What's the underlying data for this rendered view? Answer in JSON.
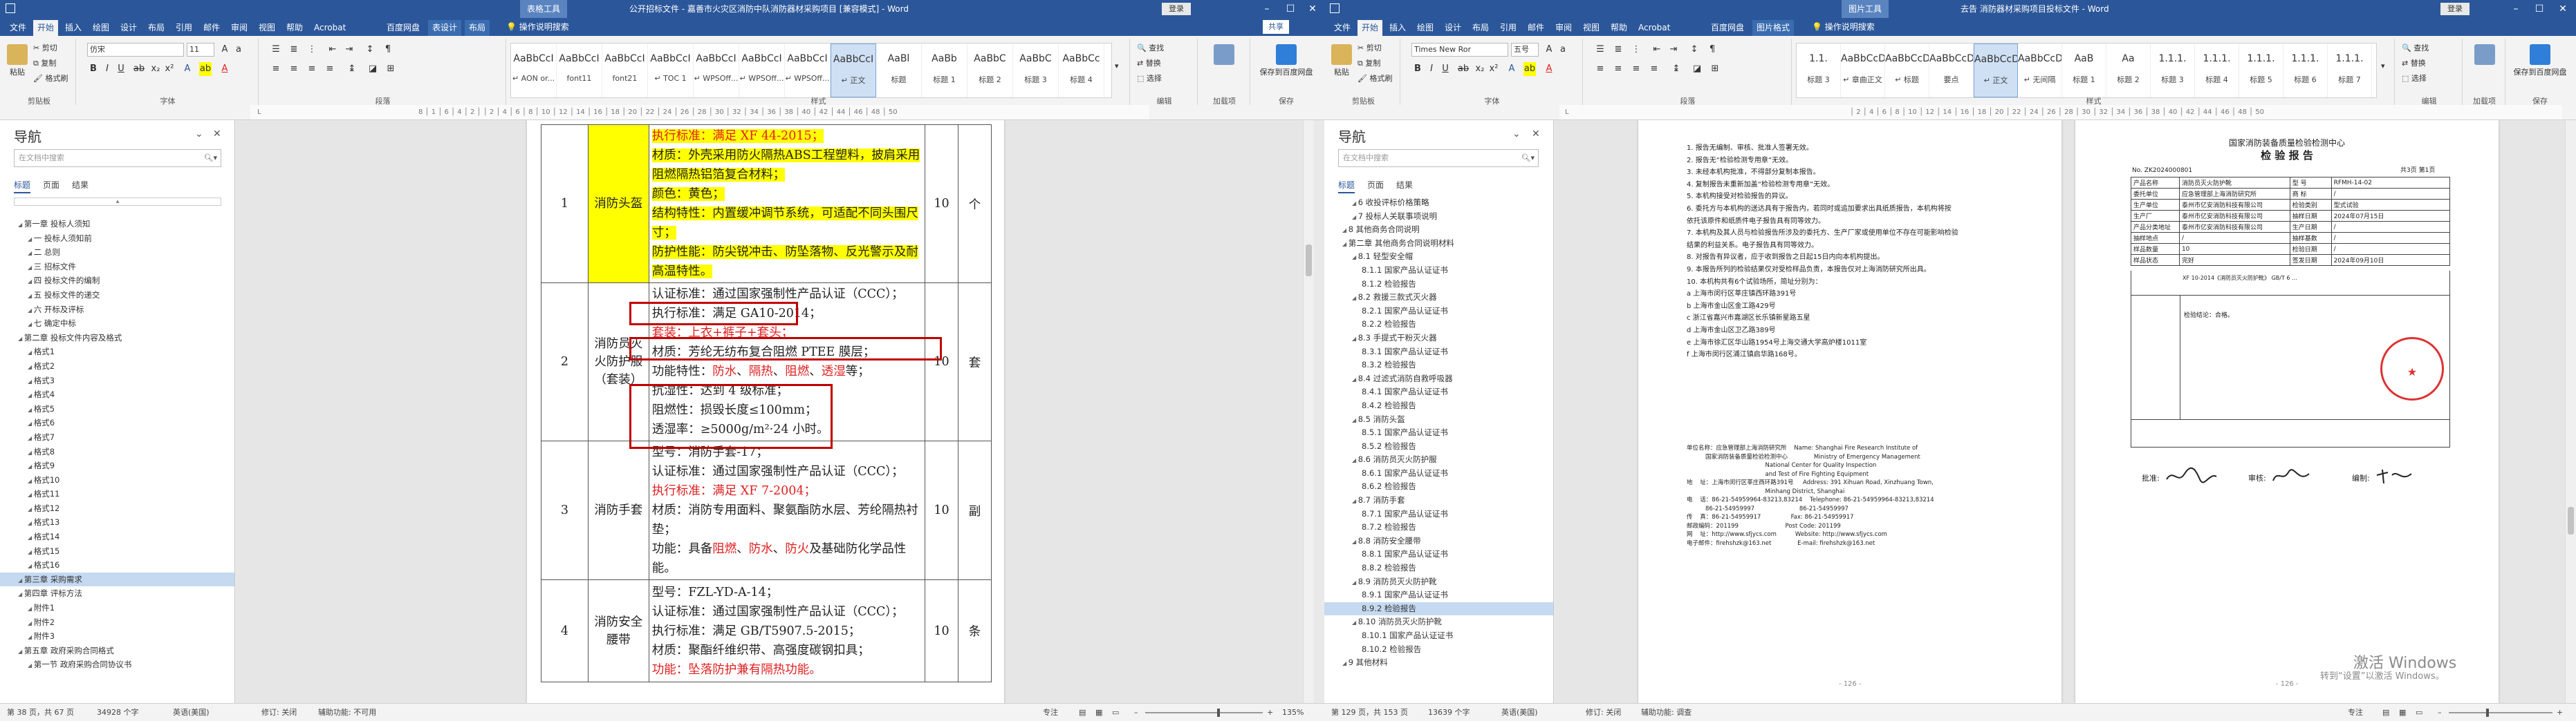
{
  "left": {
    "titlebar": {
      "context_tab": "表格工具",
      "title": "公开招标文件 - 嘉善市火灾区消防中队消防器材采购项目 [兼容模式] - Word",
      "signin": "登录"
    },
    "tabs": [
      "文件",
      "开始",
      "插入",
      "绘图",
      "设计",
      "布局",
      "引用",
      "邮件",
      "审阅",
      "视图",
      "帮助",
      "Acrobat",
      "百度网盘",
      "表设计",
      "布局"
    ],
    "tell_me": "操作说明搜索",
    "share": "共享",
    "ribbon": {
      "clipboard": {
        "paste": "粘贴",
        "cut": "剪切",
        "copy": "复制",
        "format_painter": "格式刷",
        "label": "剪贴板"
      },
      "font": {
        "name": "仿宋",
        "size": "11",
        "label": "字体"
      },
      "paragraph": {
        "label": "段落"
      },
      "styles": {
        "label": "样式",
        "items": [
          {
            "preview": "AaBbCcI",
            "name": "↵ AON or..."
          },
          {
            "preview": "AaBbCcI",
            "name": "font11"
          },
          {
            "preview": "AaBbCcI",
            "name": "font21"
          },
          {
            "preview": "AaBbCcI",
            "name": "↵ TOC 1"
          },
          {
            "preview": "AaBbCcI",
            "name": "↵ WPSOff..."
          },
          {
            "preview": "AaBbCcI",
            "name": "↵ WPSOff..."
          },
          {
            "preview": "AaBbCcI",
            "name": "↵ WPSOff..."
          },
          {
            "preview": "AaBbCcI",
            "name": "↵ 正文"
          },
          {
            "preview": "AaBl",
            "name": "标题"
          },
          {
            "preview": "AaBb",
            "name": "标题 1"
          },
          {
            "preview": "AaBbC",
            "name": "标题 2"
          },
          {
            "preview": "AaBbC",
            "name": "标题 3"
          },
          {
            "preview": "AaBbCc",
            "name": "标题 4"
          }
        ]
      },
      "editing": {
        "find": "查找",
        "replace": "替换",
        "select": "选择",
        "label": "编辑"
      },
      "reuse": {
        "save": "保存到百度网盘",
        "label": "保存"
      },
      "addin": {
        "label": "加载项"
      }
    },
    "nav": {
      "title": "导航",
      "search_placeholder": "在文档中搜索",
      "tabs": [
        "标题",
        "页面",
        "结果"
      ],
      "items": [
        {
          "text": "第一章  投标人须知",
          "level": 0
        },
        {
          "text": "一  投标人须知前",
          "level": 1
        },
        {
          "text": "二  总则",
          "level": 1
        },
        {
          "text": "三  招标文件",
          "level": 1
        },
        {
          "text": "四  投标文件的编制",
          "level": 1
        },
        {
          "text": "五  投标文件的递交",
          "level": 1
        },
        {
          "text": "六  开标及评标",
          "level": 1
        },
        {
          "text": "七  确定中标",
          "level": 1
        },
        {
          "text": "第二章  投标文件内容及格式",
          "level": 0
        },
        {
          "text": "格式1",
          "level": 1
        },
        {
          "text": "格式2",
          "level": 1
        },
        {
          "text": "格式3",
          "level": 1
        },
        {
          "text": "格式4",
          "level": 1
        },
        {
          "text": "格式5",
          "level": 1
        },
        {
          "text": "格式6",
          "level": 1
        },
        {
          "text": "格式7",
          "level": 1
        },
        {
          "text": "格式8",
          "level": 1
        },
        {
          "text": "格式9",
          "level": 1
        },
        {
          "text": "格式10",
          "level": 1
        },
        {
          "text": "格式11",
          "level": 1
        },
        {
          "text": "格式12",
          "level": 1
        },
        {
          "text": "格式13",
          "level": 1
        },
        {
          "text": "格式14",
          "level": 1
        },
        {
          "text": "格式15",
          "level": 1
        },
        {
          "text": "格式16",
          "level": 1
        },
        {
          "text": "第三章  采购需求",
          "level": 0,
          "selected": true
        },
        {
          "text": "第四章  评标方法",
          "level": 0
        },
        {
          "text": "附件1",
          "level": 1
        },
        {
          "text": "附件2",
          "level": 1
        },
        {
          "text": "附件3",
          "level": 1
        },
        {
          "text": "第五章  政府采购合同格式",
          "level": 0
        },
        {
          "text": "第一节  政府采购合同协议书",
          "level": 1
        }
      ]
    },
    "table": {
      "rows": [
        {
          "no": "1",
          "name": "消防头盔",
          "qty": "10",
          "unit": "个",
          "lines": [
            {
              "t": "执行标准：满足 XF 44-2015；",
              "red": true,
              "hl": true
            },
            {
              "t": "材质：外壳采用防火隔热ABS工程塑料，披肩采用阻燃隔热铝箔复合材料；",
              "hl": true
            },
            {
              "t": "颜色：黄色；",
              "hl": true
            },
            {
              "t": "结构特性：内置缓冲调节系统，可适配不同头围尺寸；",
              "hl": true
            },
            {
              "t": "防护性能：防尖锐冲击、防坠落物、反光警示及耐高温特性。",
              "hl": true
            }
          ]
        },
        {
          "no": "2",
          "name": "消防员灭火防护服（套装）",
          "qty": "10",
          "unit": "套",
          "lines": [
            {
              "t": "认证标准：通过国家强制性产品认证（CCC）；"
            },
            {
              "t": "执行标准：满足 GA10-2014；"
            },
            {
              "t": "套装：上衣+裤子+套头；",
              "red": true
            },
            {
              "t": "材质：芳纶无纺布复合阻燃 PTEE 膜层；"
            },
            {
              "t": "功能特性：防水、隔热、阻燃、透湿等；",
              "mixed": true
            },
            {
              "t": "抗湿性：达到 4 级标准；"
            },
            {
              "t": "阻燃性：损毁长度≤100mm；"
            },
            {
              "t": "透湿率：≥5000g/m²·24 小时。"
            }
          ]
        },
        {
          "no": "3",
          "name": "消防手套",
          "qty": "10",
          "unit": "副",
          "lines": [
            {
              "t": "型号：消防手套-17；"
            },
            {
              "t": "认证标准：通过国家强制性产品认证（CCC）；"
            },
            {
              "t": "执行标准：满足 XF 7-2004；",
              "red": true
            },
            {
              "t": "材质：消防专用面料、聚氨酯防水层、芳纶隔热衬垫；"
            },
            {
              "t": "功能：具备阻燃、防水、防火及基础防化学品性能。",
              "mixed2": true
            }
          ]
        },
        {
          "no": "4",
          "name": "消防安全腰带",
          "qty": "10",
          "unit": "条",
          "lines": [
            {
              "t": "型号：FZL-YD-A-14；"
            },
            {
              "t": "认证标准：通过国家强制性产品认证（CCC）；"
            },
            {
              "t": "执行标准：满足 GB/T5907.5-2015；"
            },
            {
              "t": "材质：聚酯纤维织带、高强度碳钢扣具；"
            },
            {
              "t": "功能：坠落防护兼有隔热功能。",
              "red": true
            }
          ]
        }
      ]
    },
    "status": {
      "page": "第 38 页，共 67 页",
      "words": "34928 个字",
      "lang": "英语(美国)",
      "track": "修订: 关闭",
      "access": "辅助功能: 不可用",
      "focus": "专注",
      "zoom": "135%"
    }
  },
  "right": {
    "titlebar": {
      "context_tab": "图片工具",
      "title": "去告 消防器材采购项目投标文件 - Word",
      "signin": "登录"
    },
    "tabs": [
      "文件",
      "开始",
      "插入",
      "绘图",
      "设计",
      "布局",
      "引用",
      "邮件",
      "审阅",
      "视图",
      "帮助",
      "Acrobat",
      "百度网盘",
      "图片格式"
    ],
    "tell_me": "操作说明搜索",
    "ribbon": {
      "clipboard": {
        "paste": "粘贴",
        "cut": "剪切",
        "copy": "复制",
        "format_painter": "格式刷",
        "label": "剪贴板"
      },
      "font": {
        "name": "Times New Ror",
        "size": "五号",
        "label": "字体"
      },
      "paragraph": {
        "label": "段落"
      },
      "styles": {
        "label": "样式",
        "items": [
          {
            "preview": "1.1.",
            "name": "标题 3"
          },
          {
            "preview": "AaBbCcD",
            "name": "↵ 章曲正文"
          },
          {
            "preview": "AaBbCcD",
            "name": "↵ 标题"
          },
          {
            "preview": "AaBbCcD",
            "name": "要点"
          },
          {
            "preview": "AaBbCcD",
            "name": "↵ 正文"
          },
          {
            "preview": "AaBbCcD",
            "name": "↵ 无间隔"
          },
          {
            "preview": "AaB",
            "name": "标题 1"
          },
          {
            "preview": "Aa",
            "name": "标题 2"
          },
          {
            "preview": "1.1.1.",
            "name": "标题 3"
          },
          {
            "preview": "1.1.1.",
            "name": "标题 4"
          },
          {
            "preview": "1.1.1.",
            "name": "标题 5"
          },
          {
            "preview": "1.1.1.",
            "name": "标题 6"
          },
          {
            "preview": "1.1.1.",
            "name": "标题 7"
          }
        ]
      },
      "editing": {
        "find": "查找",
        "replace": "替换",
        "select": "选择",
        "label": "编辑"
      },
      "reuse": {
        "save": "保存到百度网盘",
        "label": "保存"
      },
      "addin": {
        "label": "加载项"
      }
    },
    "nav": {
      "title": "导航",
      "search_placeholder": "在文档中搜索",
      "tabs": [
        "标题",
        "页面",
        "结果"
      ],
      "items": [
        {
          "text": "6 收投评标价格策略",
          "level": 1
        },
        {
          "text": "7 投标人关联事项说明",
          "level": 1
        },
        {
          "text": "8  其他商务合同说明",
          "level": 0
        },
        {
          "text": "第二章  其他商务合同说明材料",
          "level": 0
        },
        {
          "text": "8.1 轻型安全帽",
          "level": 1
        },
        {
          "text": "8.1.1 国家产品认证证书",
          "level": 2
        },
        {
          "text": "8.1.2 检验报告",
          "level": 2
        },
        {
          "text": "8.2 救援三款式灭火器",
          "level": 1
        },
        {
          "text": "8.2.1 国家产品认证证书",
          "level": 2
        },
        {
          "text": "8.2.2 检验报告",
          "level": 2
        },
        {
          "text": "8.3 手提式干粉灭火器",
          "level": 1
        },
        {
          "text": "8.3.1 国家产品认证证书",
          "level": 2
        },
        {
          "text": "8.3.2 检验报告",
          "level": 2
        },
        {
          "text": "8.4 过滤式消防自救呼吸器",
          "level": 1
        },
        {
          "text": "8.4.1 国家产品认证证书",
          "level": 2
        },
        {
          "text": "8.4.2 检验报告",
          "level": 2
        },
        {
          "text": "8.5 消防头盔",
          "level": 1
        },
        {
          "text": "8.5.1 国家产品认证证书",
          "level": 2
        },
        {
          "text": "8.5.2 检验报告",
          "level": 2
        },
        {
          "text": "8.6 消防员灭火防护服",
          "level": 1
        },
        {
          "text": "8.6.1 国家产品认证证书",
          "level": 2
        },
        {
          "text": "8.6.2 检验报告",
          "level": 2
        },
        {
          "text": "8.7 消防手套",
          "level": 1
        },
        {
          "text": "8.7.1 国家产品认证证书",
          "level": 2
        },
        {
          "text": "8.7.2 检验报告",
          "level": 2
        },
        {
          "text": "8.8 消防安全腰带",
          "level": 1
        },
        {
          "text": "8.8.1 国家产品认证证书",
          "level": 2
        },
        {
          "text": "8.8.2 检验报告",
          "level": 2
        },
        {
          "text": "8.9 消防员灭火防护靴",
          "level": 1
        },
        {
          "text": "8.9.1 国家产品认证证书",
          "level": 2
        },
        {
          "text": "8.9.2 检验报告",
          "level": 2,
          "selected": true
        },
        {
          "text": "8.10 消防员灭火防护靴",
          "level": 1
        },
        {
          "text": "8.10.1 国家产品认证证书",
          "level": 2
        },
        {
          "text": "8.10.2 检验报告",
          "level": 2
        },
        {
          "text": "9  其他材料",
          "level": 0
        }
      ]
    },
    "report_left": {
      "lines": [
        "1. 报告无编制、审核、批准人签署无效。",
        "2. 报告无“检验检测专用章”无效。",
        "3. 未经本机构批准，不得部分复制本报告。",
        "4. 复制报告未重新加盖“检验检测专用章”无效。",
        "5. 本机构接受对检验报告的异议。",
        "6. 委托方与本机构的送达具有于报告内，若同时或追加要求出具纸质报告，本机构将按",
        "   依托该原件和纸质件电子报告具有同等效力。",
        "7. 本机构及其人员与检验报告所涉及的委托方、生产厂家或使用单位不存在可能影响检验",
        "   结果的利益关系。电子报告具有同等效力。",
        "8. 对报告有异议者，应于收到报告之日起15日内向本机构提出。",
        "9. 本报告所列的检验结果仅对受检样品负责，本报告仅对上海消防研究所出具。",
        "10. 本机构共有6个试验场所，简址分别为：",
        "a 上海市闵行区莘庄镇西环路391号",
        "b 上海市金山区金工路429号",
        "c 浙江省嘉兴市嘉湖区长乐镇新星路五星",
        "d 上海市金山区卫乙路389号",
        "e 上海市徐汇区华山路1954号上海交通大学高炉楼1011室",
        "f 上海市闵行区浦江镇启华路168号。"
      ],
      "footer": [
        "单位名称：应急管理部上海消防研究所    Name: Shanghai Fire Research Institute of",
        "          国家消防装备质量检验检测中心              Ministry of Emergency Management",
        "                                          National Center for Quality Inspection",
        "                                          and Test of Fire Fighting Equipment",
        "地    址：上海市闵行区莘庄西环路391号     Address: 391 Xihuan Road, Xinzhuang Town,",
        "                                          Minhang District, Shanghai",
        "电    话：86-21-54959964-83213,83214    Telephone: 86-21-54959964-83213,83214",
        "          86-21-54959997                        86-21-54959997",
        "传    真：86-21-54959917                Fax: 86-21-54959917",
        "邮政编码：201199                         Post Code: 201199",
        "网    址：http://www.sfjycs.com          Website: http://www.sfjycs.com",
        "电子邮件：firehshzk@163.net              E-mail: firehshzk@163.net"
      ],
      "page_no": "- 126 -"
    },
    "report_right": {
      "title1": "国家消防装备质量检验检测中心",
      "title2": "检 验 报 告",
      "report_no": "No. ZK2024000801",
      "page_info": "共3页  第1页",
      "rows": [
        [
          "产品名称",
          "消防员灭火防护靴",
          "型    号",
          "RFMH-14-02"
        ],
        [
          "委托单位",
          "应急管理部上海消防研究所",
          "商    标",
          "/"
        ],
        [
          "生产单位",
          "泰州市亿安消防科技有限公司",
          "检验类别",
          "型式试验"
        ],
        [
          "生产厂",
          "泰州市亿安消防科技有限公司",
          "抽样日期",
          "2024年07月15日"
        ],
        [
          "产品分类地址",
          "泰州市亿安消防科技有限公司",
          "生产日期",
          "/"
        ],
        [
          "抽样地点",
          "/",
          "抽样基数",
          "/"
        ],
        [
          "样品数量",
          "10",
          "检验日期",
          "/"
        ],
        [
          "样品状态",
          "完好",
          "签发日期",
          "2024年09月10日"
        ]
      ],
      "basis": "XF 10-2014《消防员灭火防护靴》  GB/T 6 ...",
      "conclusion": "检验结论：合格。",
      "sign_labels": [
        "批准:",
        "审核:",
        "编制:"
      ],
      "page_no": "- 126 -"
    },
    "status": {
      "page": "第 129 页，共 153 页",
      "words": "13639 个字",
      "lang": "英语(美国)",
      "track": "修订: 关闭",
      "access": "辅助功能: 调查",
      "focus": "专注"
    },
    "watermark1": "激活 Windows",
    "watermark2": "转到“设置”以激活 Windows。"
  },
  "colors": {
    "word_blue": "#2b579a",
    "highlight": "#ffff00",
    "red_text": "#e02020",
    "red_box": "#c00000"
  },
  "icons": [
    "paste-icon",
    "cut-icon",
    "copy-icon",
    "format-painter-icon",
    "bold-icon",
    "italic-icon",
    "underline-icon",
    "search-icon",
    "close-icon",
    "chevron-down-icon",
    "minimize-icon",
    "maximize-icon"
  ]
}
